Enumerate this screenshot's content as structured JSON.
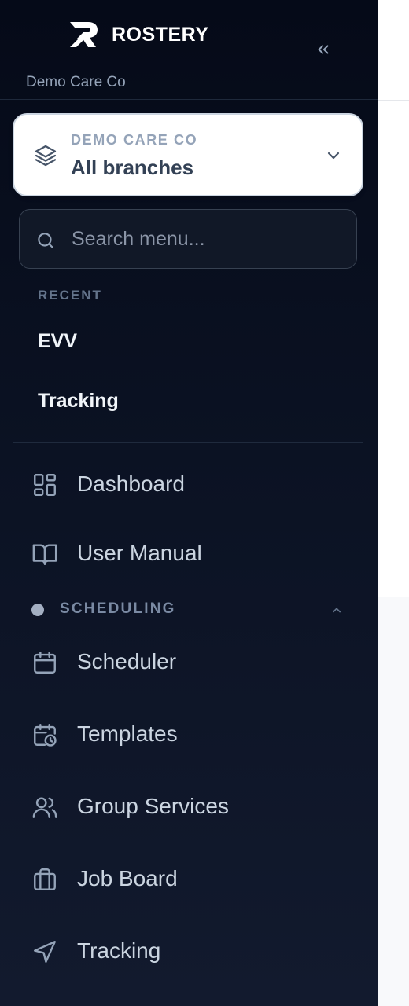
{
  "brand": {
    "name": "ROSTERY",
    "org_caption": "Demo Care Co"
  },
  "branch_selector": {
    "org_label": "DEMO CARE CO",
    "selected": "All branches"
  },
  "search": {
    "placeholder": "Search menu..."
  },
  "recent": {
    "heading": "RECENT",
    "items": [
      {
        "label": "EVV"
      },
      {
        "label": "Tracking"
      }
    ]
  },
  "nav": {
    "items": [
      {
        "label": "Dashboard",
        "icon": "dashboard-grid-icon"
      },
      {
        "label": "User Manual",
        "icon": "book-open-icon"
      }
    ]
  },
  "scheduling": {
    "heading": "SCHEDULING",
    "expanded": true,
    "items": [
      {
        "label": "Scheduler",
        "icon": "calendar-icon"
      },
      {
        "label": "Templates",
        "icon": "calendar-clock-icon"
      },
      {
        "label": "Group Services",
        "icon": "users-icon"
      },
      {
        "label": "Job Board",
        "icon": "briefcase-icon"
      },
      {
        "label": "Tracking",
        "icon": "navigation-arrow-icon"
      }
    ]
  },
  "colors": {
    "sidebar_bg_top": "#050a18",
    "sidebar_bg_bottom": "#121a2e",
    "text_primary": "#f1f5f9",
    "text_muted": "#94a3b8",
    "card_bg": "#ffffff"
  }
}
